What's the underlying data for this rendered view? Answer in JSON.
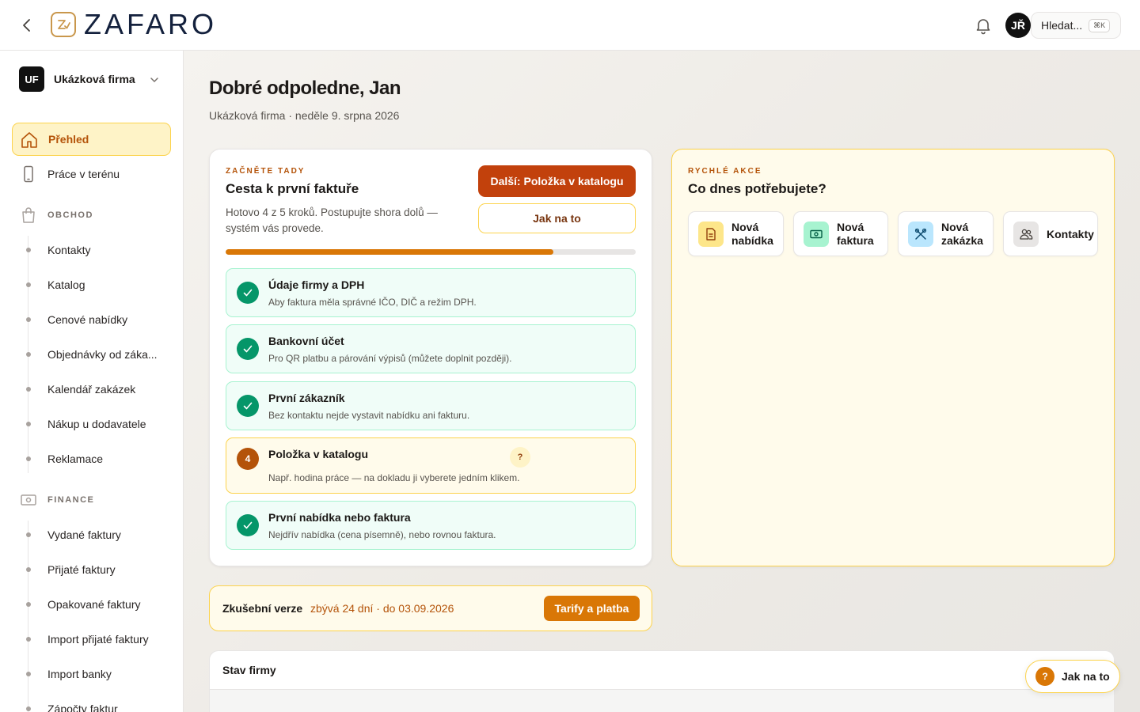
{
  "header": {
    "logo_text": "ZAFARO",
    "avatar_initials": "JŘ",
    "search_label": "Hledat...",
    "search_shortcut": "⌘K"
  },
  "sidebar": {
    "company_initials": "UF",
    "company_name": "Ukázková firma",
    "items": [
      {
        "label": "Přehled",
        "active": true
      },
      {
        "label": "Práce v terénu"
      }
    ],
    "sections": [
      {
        "label": "OBCHOD",
        "items": [
          "Kontakty",
          "Katalog",
          "Cenové nabídky",
          "Objednávky od záka...",
          "Kalendář zakázek",
          "Nákup u dodavatele",
          "Reklamace"
        ]
      },
      {
        "label": "FINANCE",
        "items": [
          "Vydané faktury",
          "Přijaté faktury",
          "Opakované faktury",
          "Import přijaté faktury",
          "Import banky",
          "Zápočty faktur"
        ]
      }
    ]
  },
  "main": {
    "greeting": "Dobré odpoledne, Jan",
    "subline": "Ukázková firma · neděle 9. srpna 2026",
    "journey": {
      "eyebrow": "ZAČNĚTE TADY",
      "title": "Cesta k první faktuře",
      "description": "Hotovo 4 z 5 kroků. Postupujte shora dolů — systém vás provede.",
      "next_button": "Další: Položka v katalogu",
      "howto_button": "Jak na to",
      "progress_fraction": 0.8,
      "steps": [
        {
          "title": "Údaje firmy a DPH",
          "desc": "Aby faktura měla správné IČO, DIČ a režim DPH.",
          "status": "done"
        },
        {
          "title": "Bankovní účet",
          "desc": "Pro QR platbu a párování výpisů (můžete doplnit později).",
          "status": "done"
        },
        {
          "title": "První zákazník",
          "desc": "Bez kontaktu nejde vystavit nabídku ani fakturu.",
          "status": "done"
        },
        {
          "title": "Položka v katalogu",
          "desc": "Např. hodina práce — na dokladu ji vyberete jedním klikem.",
          "status": "current",
          "number": "4",
          "help": "?"
        },
        {
          "title": "První nabídka nebo faktura",
          "desc": "Nejdřív nabídka (cena písemně), nebo rovnou faktura.",
          "status": "done"
        }
      ]
    },
    "quick_actions": {
      "eyebrow": "RYCHLÉ AKCE",
      "title": "Co dnes potřebujete?",
      "actions": [
        {
          "label": "Nová nabídka",
          "icon": "document-icon",
          "color": "#fde68a"
        },
        {
          "label": "Nová faktura",
          "icon": "banknote-icon",
          "color": "#a7f3d0"
        },
        {
          "label": "Nová zakázka",
          "icon": "tools-icon",
          "color": "#bae6fd"
        },
        {
          "label": "Kontakty",
          "icon": "users-icon",
          "color": "#e7e5e4"
        }
      ]
    },
    "trial": {
      "title": "Zkušební verze",
      "info": "zbývá 24 dní · do 03.09.2026",
      "button": "Tarify a platba"
    },
    "status_card": {
      "title": "Stav firmy"
    }
  },
  "help_fab": {
    "icon": "?",
    "label": "Jak na to"
  },
  "colors": {
    "accent": "#c2410c",
    "amber": "#d97706",
    "success": "#059669"
  }
}
